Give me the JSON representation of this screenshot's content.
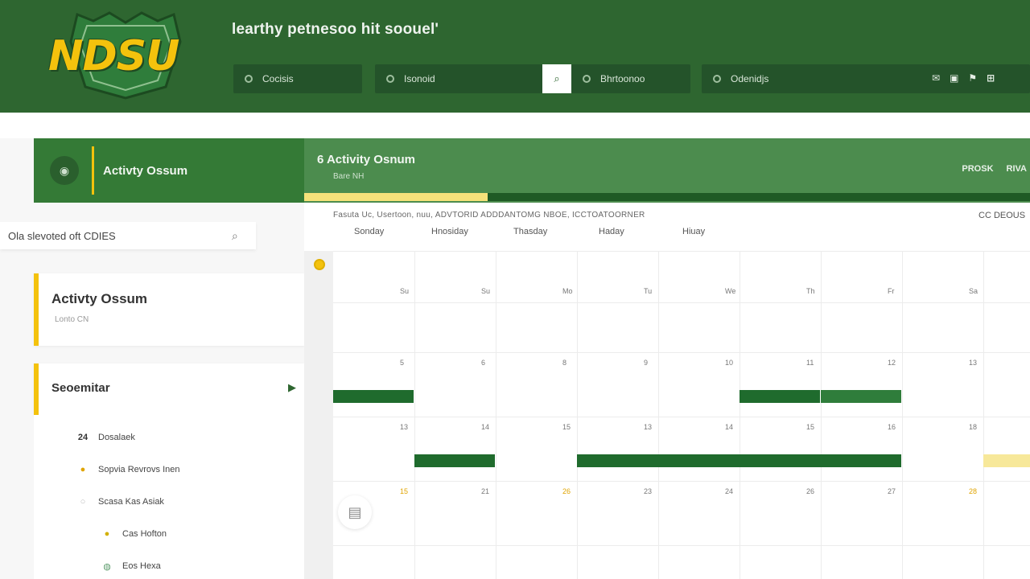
{
  "header": {
    "logo_text": "NDSU",
    "site_title": "learthy petnesoo hit soouel'",
    "nav": [
      {
        "label": "Cocisis",
        "icon": "home-icon"
      },
      {
        "label": "Isonoid",
        "icon": "search-icon"
      },
      {
        "label": "Bhrtoonoo",
        "icon": "grid-icon"
      },
      {
        "label": "Odenidjs",
        "icon": "calendar-icon"
      }
    ],
    "search_button_icon": "⌕",
    "icons": [
      "✉",
      "▣",
      "⚑",
      "⊞"
    ]
  },
  "course": {
    "badge_icon": "◉",
    "left_title": "Activty Ossum",
    "title": "6 Activity Osnum",
    "subtitle": "Bare NH",
    "actions": [
      "PROSK",
      "RIVA"
    ]
  },
  "sidebar": {
    "search_value": "Ola slevoted oft CDIES",
    "card1": {
      "title": "Activty Ossum",
      "subtitle": "Lonto CN"
    },
    "card2": {
      "title": "Seoemitar"
    },
    "items": [
      {
        "icon": "24",
        "label": "Dosalaek"
      },
      {
        "icon": "●",
        "label": "Sopvia Revrovs Inen"
      },
      {
        "icon": "○",
        "label": "Scasa Kas Asiak"
      },
      {
        "icon": "●",
        "label": "Cas Hofton"
      },
      {
        "icon": "◍",
        "label": "Eos Hexa"
      }
    ]
  },
  "calendar": {
    "breadcrumb": "Fasuta Uc, Usertoon, nuu,  ADVTORID  ADDDANTOMG NBOE, ICCTOATOORNER",
    "range": "CC  DEOUS",
    "weekdays": [
      "Sonday",
      "Hnosiday",
      "Thasday",
      "Haday",
      "Hiuay"
    ],
    "header_row": [
      "Su",
      "Su",
      "Mo",
      "Tu",
      "We",
      "Th",
      "Fr",
      "Sa"
    ],
    "week1": [
      "5",
      "6",
      "8",
      "9",
      "10",
      "11",
      "12",
      "13"
    ],
    "week2": [
      "13",
      "14",
      "15",
      "13",
      "14",
      "15",
      "16",
      "18"
    ],
    "week3": [
      "15",
      "21",
      "26",
      "23",
      "24",
      "26",
      "27",
      "28"
    ],
    "week3_highlight": [
      0,
      2,
      7
    ],
    "fab_icon": "▤",
    "events": [
      {
        "week": 1,
        "start": 0,
        "span": 1,
        "tone": "dark"
      },
      {
        "week": 1,
        "start": 5,
        "span": 1,
        "tone": "dark"
      },
      {
        "week": 1,
        "start": 6,
        "span": 1,
        "tone": "light"
      },
      {
        "week": 2,
        "start": 1,
        "span": 1,
        "tone": "dark"
      },
      {
        "week": 2,
        "start": 3,
        "span": 4,
        "tone": "dark"
      },
      {
        "week": 2,
        "start": 8,
        "span": 1,
        "tone": "yellow"
      }
    ],
    "colors": {
      "dark": "#1f6b2d",
      "light": "#2f7d3b",
      "yellow": "#f7e89a",
      "accent": "#f4c20d"
    }
  }
}
